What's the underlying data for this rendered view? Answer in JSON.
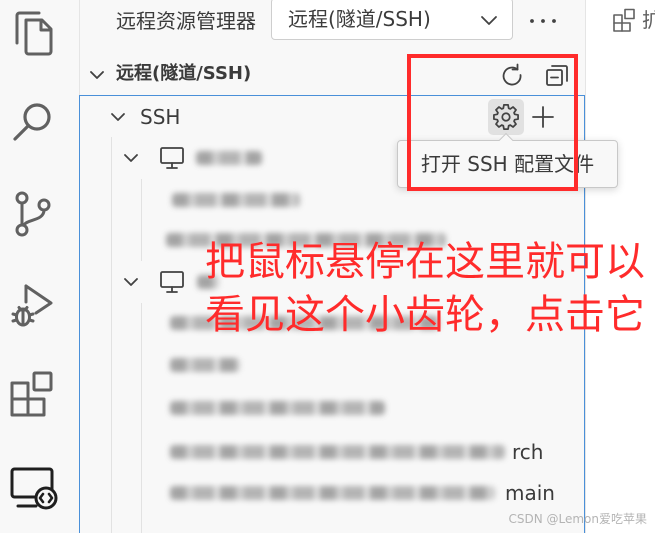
{
  "activity_bar": {
    "items": [
      {
        "icon": "files-icon",
        "active": false
      },
      {
        "icon": "search-icon",
        "active": false
      },
      {
        "icon": "source-control-icon",
        "active": false
      },
      {
        "icon": "debug-alt-icon",
        "active": false
      },
      {
        "icon": "extensions-icon",
        "active": false
      },
      {
        "icon": "remote-explorer-icon",
        "active": true
      }
    ]
  },
  "sidebar": {
    "view_title": "远程资源管理器",
    "view_selector": {
      "selected": "远程(隧道/SSH)",
      "icon": "chevron-down-icon"
    },
    "more_actions_icon": "ellipsis-icon"
  },
  "section": {
    "title": "远程(隧道/SSH)",
    "expanded": true,
    "actions": [
      {
        "icon": "refresh-icon"
      },
      {
        "icon": "collapse-all-icon"
      }
    ]
  },
  "tree": {
    "group_label": "SSH",
    "group_expanded": true,
    "group_actions": [
      {
        "icon": "gear-icon",
        "hovered": true
      },
      {
        "icon": "add-icon"
      }
    ],
    "hosts": [
      {
        "icon": "vm-icon",
        "expanded": true
      },
      {
        "icon": "vm-icon",
        "expanded": true,
        "tail_fragments": [
          "rch",
          "main"
        ]
      }
    ]
  },
  "tooltip": {
    "text": "打开 SSH 配置文件"
  },
  "editor_tab": {
    "icon": "extensions-icon",
    "label": "扩"
  },
  "annotation": {
    "lines": [
      "把鼠标悬停在这里就可以",
      "看见这个小齿轮，点击它"
    ]
  },
  "watermark": {
    "text": "CSDN @Lemon爱吃苹果"
  },
  "colors": {
    "foreground": "#3b3b3b",
    "icon": "#616161",
    "icon_active": "#1f1f1f",
    "sidebar_bg": "#f8f8f8",
    "editor_bg": "#ffffff",
    "focus_border": "#4a90d9",
    "hover_bg": "#e1e1e1",
    "annotation_red": "#ff2b2b",
    "watermark": "#b4b4b4"
  }
}
